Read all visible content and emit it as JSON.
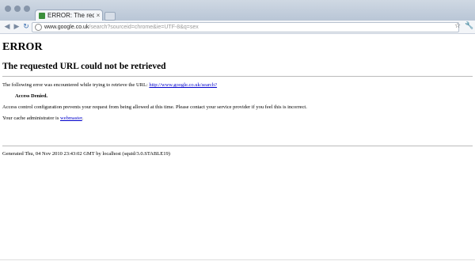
{
  "browser": {
    "tab_title": "ERROR: The requeste...",
    "tab_close": "×",
    "address_domain": "www.google.co.uk",
    "address_path": "/search?sourceid=chrome&ie=UTF-8&q=sex",
    "back_glyph": "◀",
    "forward_glyph": "▶",
    "reload_glyph": "↻",
    "star_glyph": "☆",
    "wrench_glyph": "🔧"
  },
  "page": {
    "heading": "ERROR",
    "subheading": "The requested URL could not be retrieved",
    "error_intro": "The following error was encountered while trying to retrieve the URL: ",
    "error_url": "http://www.google.co.uk/search?",
    "error_title": "Access Denied.",
    "error_desc": "Access control configuration prevents your request from being allowed at this time. Please contact your service provider if you feel this is incorrect.",
    "admin_text": "Your cache administrator is ",
    "admin_link": "webmaster",
    "admin_suffix": ".",
    "footer": "Generated Thu, 04 Nov 2010 23:43:02 GMT by localhost (squid/3.0.STABLE19)"
  }
}
